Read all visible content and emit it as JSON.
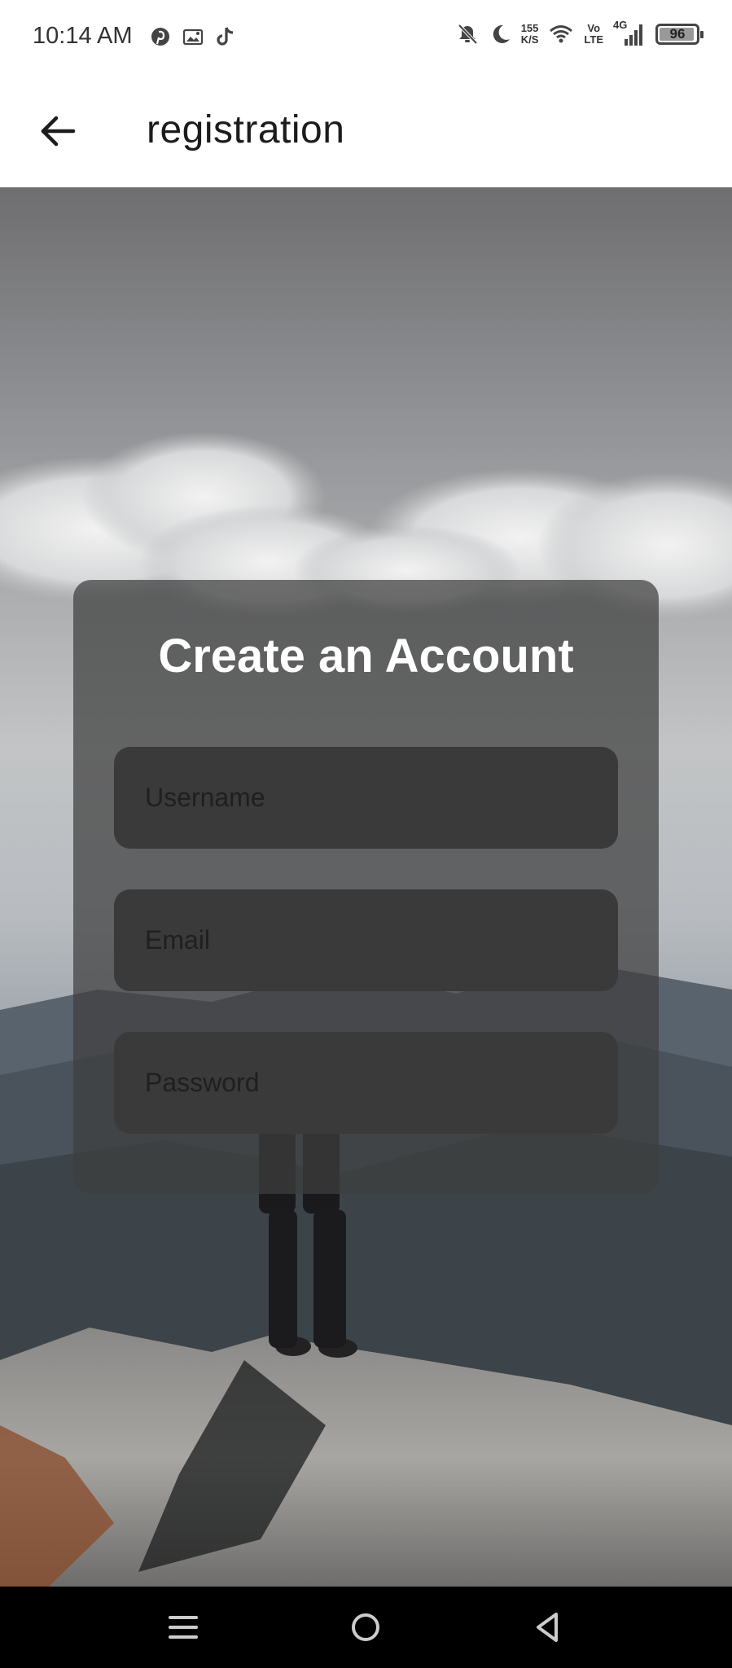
{
  "status_bar": {
    "time": "10:14 AM",
    "left_icons": [
      "pinterest-icon",
      "image-notification-icon",
      "tiktok-icon"
    ],
    "right_icons": [
      "notifications-off-icon",
      "do-not-disturb-moon-icon",
      "network-speed",
      "wifi-icon",
      "volte-icon",
      "4g-signal-icon",
      "battery-icon"
    ],
    "net_speed_value": "155",
    "net_speed_unit": "K/S",
    "volte_top": "Vo",
    "volte_bottom": "LTE",
    "network_type": "4G",
    "battery_level": "96"
  },
  "app_bar": {
    "title": "registration",
    "back_icon": "arrow-left-icon"
  },
  "card": {
    "title": "Create an Account",
    "fields": {
      "username": {
        "placeholder": "Username",
        "value": ""
      },
      "email": {
        "placeholder": "Email",
        "value": ""
      },
      "password": {
        "placeholder": "Password",
        "value": ""
      }
    }
  },
  "nav_bar": {
    "icons": [
      "menu-icon",
      "home-circle-icon",
      "back-triangle-icon"
    ]
  },
  "colors": {
    "card_overlay": "#3e3e3e",
    "field_bg": "#3a3a3a",
    "title_text": "#ffffff",
    "app_bar_bg": "#ffffff",
    "nav_bar_bg": "#000000"
  }
}
